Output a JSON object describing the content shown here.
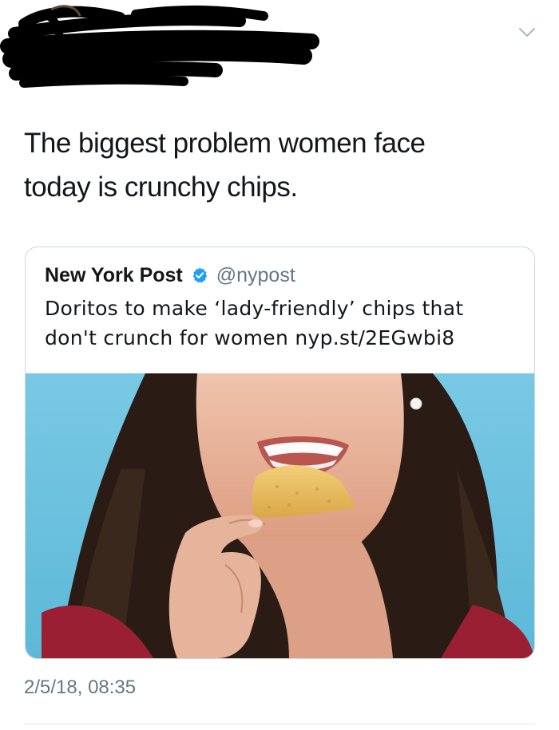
{
  "tweet": {
    "text_line_1": "The biggest problem women face",
    "text_line_2": "today is crunchy chips.",
    "timestamp": "2/5/18, 08:35"
  },
  "quoted_tweet": {
    "name": "New York Post",
    "handle": "@nypost",
    "text_line_1": "Doritos to make ‘lady-friendly’ chips that",
    "text_line_2": "don't crunch for women nyp.st/2EGwbi8",
    "verified_icon": "verified-badge-icon"
  },
  "icons": {
    "menu": "chevron-down-icon"
  },
  "colors": {
    "text": "#14171a",
    "secondary": "#657786",
    "verified_blue": "#1da1f2",
    "card_border": "#ccd6dd",
    "image_background": "#6fc3e0"
  }
}
